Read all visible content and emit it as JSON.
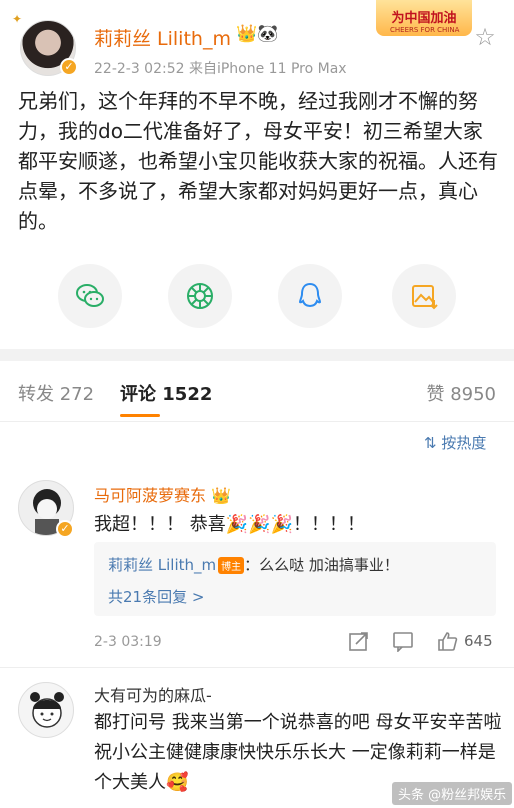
{
  "post": {
    "author": "莉莉丝 Lilith_m",
    "badges": "👑🐼",
    "meta": "22-2-3 02:52  来自iPhone 11 Pro Max",
    "promo": "为中国加油",
    "promo_sub": "CHEERS FOR CHINA",
    "body": "兄弟们，这个年拜的不早不晚，经过我刚才不懈的努力，我的do二代准备好了，母女平安！初三希望大家都平安顺遂，也希望小宝贝能收获大家的祝福。人还有点晕，不多说了，希望大家都对妈妈更好一点，真心的。"
  },
  "share": {
    "items": [
      {
        "icon": "wechat-icon",
        "color": "#2aae67"
      },
      {
        "icon": "moments-icon",
        "color": "#2aae67"
      },
      {
        "icon": "qq-icon",
        "color": "#2d8cf0"
      },
      {
        "icon": "image-icon",
        "color": "#f5a623"
      }
    ]
  },
  "tabs": {
    "repost": "转发 272",
    "comments": "评论 1522",
    "likes": "赞 8950"
  },
  "sort": {
    "label": "按热度"
  },
  "comments": [
    {
      "author": "马可阿菠萝赛东",
      "crown": "👑",
      "text": "我超！！！ 恭喜🎉🎉🎉！！！！",
      "reply": {
        "author": "莉莉丝 Lilith_m",
        "tag": "博主",
        "text": "：么么哒 加油搞事业！",
        "more": "共21条回复 >"
      },
      "time": "2-3 03:19",
      "likes": "645"
    },
    {
      "author": "大有可为的麻瓜-",
      "text": "都打问号 我来当第一个说恭喜的吧 母女平安辛苦啦 祝小公主健健康康快快乐乐长大 一定像莉莉一样是个大美人🥰"
    }
  ],
  "watermark": "头条 @粉丝邦娱乐",
  "colors": {
    "accent": "#ff8200",
    "name": "#e86b0c",
    "link": "#4a7ab0"
  }
}
